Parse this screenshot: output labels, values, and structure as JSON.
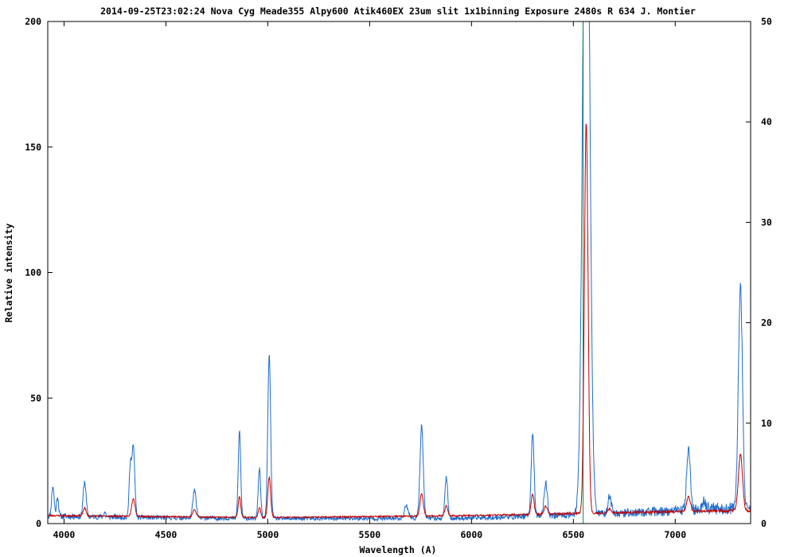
{
  "chart_data": {
    "type": "line",
    "title": "2014-09-25T23:02:24 Nova Cyg Meade355 Alpy600 Atik460EX 23um slit 1x1binning Exposure 2480s R 634 J. Montier",
    "xlabel": "Wavelength (A)",
    "ylabel": "Relative intensity",
    "xlim": [
      3920,
      7370
    ],
    "ylim": [
      0,
      200
    ],
    "y2lim": [
      0,
      50
    ],
    "x_ticks": [
      4000,
      4500,
      5000,
      5500,
      6000,
      6500,
      7000
    ],
    "y_ticks": [
      0,
      50,
      100,
      150,
      200
    ],
    "y2_ticks": [
      0,
      10,
      20,
      30,
      40,
      50
    ],
    "grid": false,
    "legend": "none",
    "colors": {
      "blue_series": "#1f6ccc",
      "red_series": "#c00000",
      "green_series": "#148a46",
      "axes": "#000000"
    },
    "baseline": {
      "blue": [
        [
          3920,
          3.0
        ],
        [
          4500,
          2.3
        ],
        [
          5000,
          2.0
        ],
        [
          5500,
          2.0
        ],
        [
          6000,
          2.2
        ],
        [
          6500,
          3.5
        ],
        [
          7000,
          5.0
        ],
        [
          7200,
          6.0
        ],
        [
          7370,
          6.0
        ]
      ],
      "red": [
        [
          3920,
          0.8
        ],
        [
          5000,
          0.6
        ],
        [
          6000,
          0.8
        ],
        [
          7000,
          1.2
        ],
        [
          7370,
          1.3
        ]
      ]
    },
    "series": [
      {
        "axis": "left",
        "color": "#1f6ccc",
        "lines": [
          {
            "x": 3945,
            "y": 12.0,
            "w": 6
          },
          {
            "x": 3968,
            "y": 8.0,
            "w": 5
          },
          {
            "x": 4101,
            "y": 14.0,
            "w": 7
          },
          {
            "x": 4200,
            "y": 2.0,
            "w": 5
          },
          {
            "x": 4325,
            "y": 19.0,
            "w": 6
          },
          {
            "x": 4340,
            "y": 28.0,
            "w": 7
          },
          {
            "x": 4640,
            "y": 11.0,
            "w": 8
          },
          {
            "x": 4861,
            "y": 35.0,
            "w": 6
          },
          {
            "x": 4959,
            "y": 20.0,
            "w": 6
          },
          {
            "x": 5007,
            "y": 65.0,
            "w": 7
          },
          {
            "x": 5680,
            "y": 5.0,
            "w": 10
          },
          {
            "x": 5755,
            "y": 37.0,
            "w": 8
          },
          {
            "x": 5876,
            "y": 16.0,
            "w": 7
          },
          {
            "x": 6300,
            "y": 33.0,
            "w": 7
          },
          {
            "x": 6364,
            "y": 13.0,
            "w": 8
          },
          {
            "x": 6563,
            "y": 320.0,
            "w": 16
          },
          {
            "x": 6678,
            "y": 7.0,
            "w": 8
          },
          {
            "x": 7065,
            "y": 24.0,
            "w": 9
          },
          {
            "x": 7140,
            "y": 3.0,
            "w": 10
          },
          {
            "x": 7320,
            "y": 88.0,
            "w": 10
          }
        ]
      },
      {
        "axis": "right",
        "color": "#c00000",
        "lines": [
          {
            "x": 4101,
            "y": 0.8,
            "w": 7
          },
          {
            "x": 4340,
            "y": 1.8,
            "w": 8
          },
          {
            "x": 4640,
            "y": 0.7,
            "w": 8
          },
          {
            "x": 4861,
            "y": 2.1,
            "w": 6
          },
          {
            "x": 4959,
            "y": 1.0,
            "w": 6
          },
          {
            "x": 5007,
            "y": 4.0,
            "w": 7
          },
          {
            "x": 5755,
            "y": 2.2,
            "w": 8
          },
          {
            "x": 5876,
            "y": 1.0,
            "w": 7
          },
          {
            "x": 6300,
            "y": 2.0,
            "w": 7
          },
          {
            "x": 6364,
            "y": 0.8,
            "w": 8
          },
          {
            "x": 6563,
            "y": 39.0,
            "w": 9
          },
          {
            "x": 6678,
            "y": 0.4,
            "w": 8
          },
          {
            "x": 7065,
            "y": 1.4,
            "w": 9
          },
          {
            "x": 7320,
            "y": 5.6,
            "w": 10
          }
        ]
      },
      {
        "axis": "left",
        "color": "#148a46",
        "lines": [
          {
            "x": 6548,
            "y": 300.0,
            "w": 0.8
          }
        ]
      }
    ]
  }
}
